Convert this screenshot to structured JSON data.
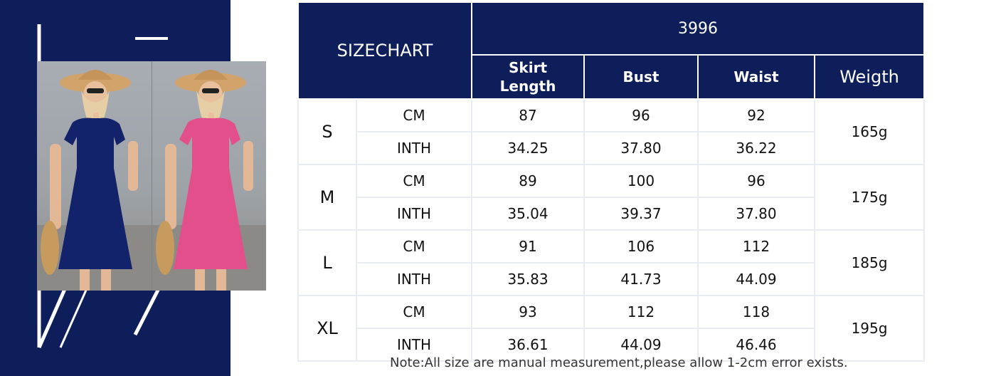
{
  "colors": {
    "brand_navy": "#0d1e5a",
    "table_border": "#e9edf3"
  },
  "photos": [
    {
      "dress_color": "#13236b"
    },
    {
      "dress_color": "#e24f8a"
    }
  ],
  "table": {
    "title": "SIZECHART",
    "model": "3996",
    "headers": {
      "skirt_length": "Skirt\nLength",
      "bust": "Bust",
      "waist": "Waist",
      "weight": "Weigth"
    },
    "rows": [
      {
        "size": "S",
        "weight": "165g",
        "cm": {
          "label": "CM",
          "skirt": "87",
          "bust": "96",
          "waist": "92"
        },
        "inth": {
          "label": "INTH",
          "skirt": "34.25",
          "bust": "37.80",
          "waist": "36.22"
        }
      },
      {
        "size": "M",
        "weight": "175g",
        "cm": {
          "label": "CM",
          "skirt": "89",
          "bust": "100",
          "waist": "96"
        },
        "inth": {
          "label": "INTH",
          "skirt": "35.04",
          "bust": "39.37",
          "waist": "37.80"
        }
      },
      {
        "size": "L",
        "weight": "185g",
        "cm": {
          "label": "CM",
          "skirt": "91",
          "bust": "106",
          "waist": "112"
        },
        "inth": {
          "label": "INTH",
          "skirt": "35.83",
          "bust": "41.73",
          "waist": "44.09"
        }
      },
      {
        "size": "XL",
        "weight": "195g",
        "cm": {
          "label": "CM",
          "skirt": "93",
          "bust": "112",
          "waist": "118"
        },
        "inth": {
          "label": "INTH",
          "skirt": "36.61",
          "bust": "44.09",
          "waist": "46.46"
        }
      }
    ]
  },
  "note": "Note:All size are manual measurement,please allow 1-2cm error exists."
}
